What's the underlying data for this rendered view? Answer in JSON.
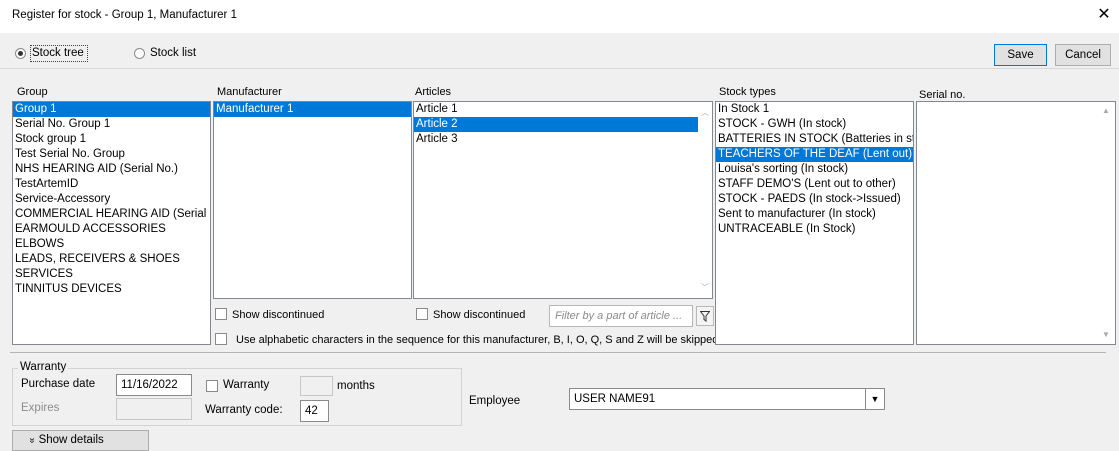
{
  "window": {
    "title": "Register for stock - Group 1, Manufacturer 1",
    "close_glyph": "✕"
  },
  "toolbar": {
    "view_options": [
      "Stock tree",
      "Stock list"
    ],
    "selected_view": "Stock tree",
    "save_label": "Save",
    "cancel_label": "Cancel"
  },
  "columns": {
    "group": {
      "label": "Group",
      "items": [
        "Group 1",
        "Serial No. Group 1",
        "Stock group 1",
        "Test Serial No. Group",
        "NHS HEARING AID (Serial No.)",
        "TestArtemID",
        "Service-Accessory",
        "COMMERCIAL HEARING AID (Serial No.)",
        "EARMOULD ACCESSORIES",
        "ELBOWS",
        "LEADS, RECEIVERS & SHOES",
        "SERVICES",
        "TINNITUS DEVICES"
      ],
      "selected_index": 0
    },
    "manufacturer": {
      "label": "Manufacturer",
      "items": [
        "Manufacturer 1"
      ],
      "selected_index": 0,
      "show_discontinued_label": "Show discontinued"
    },
    "articles": {
      "label": "Articles",
      "items": [
        "Article 1",
        "Article 2",
        "Article 3"
      ],
      "selected_index": 1,
      "show_discontinued_label": "Show discontinued",
      "filter_placeholder": "Filter by a part of article ...",
      "filter_icon": "funnel-icon"
    },
    "stock_types": {
      "label": "Stock types",
      "items": [
        "In Stock 1",
        "STOCK - GWH (In stock)",
        "BATTERIES IN STOCK (Batteries in stock)",
        "TEACHERS OF THE DEAF (Lent out)",
        "Louisa's sorting (In stock)",
        "STAFF DEMO'S (Lent out to other)",
        "STOCK - PAEDS (In stock->Issued)",
        "Sent to manufacturer (In stock)",
        "UNTRACEABLE (In Stock)"
      ],
      "selected_index": 3
    },
    "serial_no": {
      "label": "Serial no.",
      "items": []
    }
  },
  "alphabetic_option": {
    "label": "Use alphabetic characters in the sequence for this manufacturer, B, I, O, Q, S and Z will be skipped",
    "checked": false
  },
  "warranty": {
    "legend": "Warranty",
    "purchase_date_label": "Purchase date",
    "purchase_date_value": "11/16/2022",
    "warranty_checkbox_label": "Warranty",
    "months_value": "",
    "months_label": "months",
    "expires_label": "Expires",
    "expires_value": "",
    "warranty_code_label": "Warranty code:",
    "warranty_code_value": "42"
  },
  "employee": {
    "label": "Employee",
    "value": "USER NAME91"
  },
  "show_details_label": "Show details",
  "show_details_icon": "double-chevron-down-icon"
}
